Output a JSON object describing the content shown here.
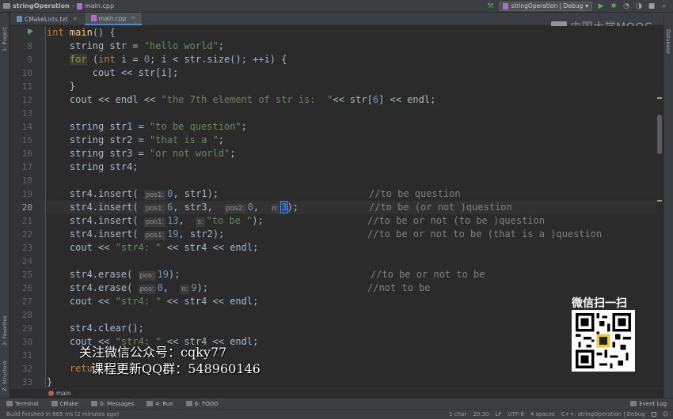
{
  "titlebar": {
    "project": "stringOperation",
    "file": "main.cpp",
    "run_config": "stringOperation | Debug"
  },
  "left_tools": {
    "project": "1: Project",
    "favorites": "2: Favorites",
    "structure": "Z: Structure"
  },
  "right_tools": {
    "database": "Database"
  },
  "tabs": [
    {
      "label": "CMakeLists.txt",
      "active": false
    },
    {
      "label": "main.cpp",
      "active": true
    }
  ],
  "watermark": "中国大学MOOC",
  "line_numbers": [
    "7",
    "8",
    "9",
    "10",
    "11",
    "12",
    "13",
    "14",
    "15",
    "16",
    "17",
    "18",
    "19",
    "20",
    "21",
    "22",
    "23",
    "24",
    "25",
    "26",
    "27",
    "28",
    "29",
    "30",
    "31",
    "32",
    "33"
  ],
  "current_line": "20",
  "code": {
    "l7_kw": "int",
    "l7_fn": "main",
    "l7_rest": "() {",
    "l8_a": "    string str = ",
    "l8_s": "\"hello world\"",
    "l8_b": ";",
    "l9_kw": "for",
    "l9_a": " (",
    "l9_kw2": "int",
    "l9_b": " i = ",
    "l9_n": "0",
    "l9_c": "; i < str.size(); ++i) {",
    "l10": "        cout << str[i];",
    "l11": "    }",
    "l12_a": "    cout << endl << ",
    "l12_s": "\"the 7th element of str is:  \"",
    "l12_b": "<< str[",
    "l12_n": "6",
    "l12_c": "] << endl;",
    "l14_a": "    string str1 = ",
    "l14_s": "\"to be question\"",
    "l14_b": ";",
    "l15_a": "    string str2 = ",
    "l15_s": "\"that is a \"",
    "l15_b": ";",
    "l16_a": "    string str3 = ",
    "l16_s": "\"or not world\"",
    "l16_b": ";",
    "l17": "    string str4;",
    "l19_a": "    str4.insert( ",
    "l19_h1": "pos1:",
    "l19_n1": "0",
    "l19_b": ", str1);",
    "l19_c": "//to be question",
    "l20_a": "    str4.insert( ",
    "l20_h1": "pos1:",
    "l20_n1": "6",
    "l20_b": ", str3,  ",
    "l20_h2": "pos2:",
    "l20_n2": "0",
    "l20_c": ",  ",
    "l20_h3": "n:",
    "l20_n3": "3",
    "l20_d": ");",
    "l20_cmt": "//to be (or not )question",
    "l21_a": "    str4.insert( ",
    "l21_h1": "pos1:",
    "l21_n1": "13",
    "l21_b": ",  ",
    "l21_h2": "s:",
    "l21_s": "\"to be \"",
    "l21_c": ");",
    "l21_cmt": "//to be or not (to be )question",
    "l22_a": "    str4.insert( ",
    "l22_h1": "pos1:",
    "l22_n1": "19",
    "l22_b": ", str2);",
    "l22_cmt": "//to be or not to be (that is a )question",
    "l23_a": "    cout << ",
    "l23_s": "\"str4: \"",
    "l23_b": " << str4 << endl;",
    "l25_a": "    str4.erase( ",
    "l25_h1": "pos:",
    "l25_n1": "19",
    "l25_b": ");",
    "l25_cmt": "//to be or not to be",
    "l26_a": "    str4.erase( ",
    "l26_h1": "pos:",
    "l26_n1": "0",
    "l26_b": ",  ",
    "l26_h2": "n:",
    "l26_n2": "9",
    "l26_c": ");",
    "l26_cmt": "//not to be",
    "l27_a": "    cout << ",
    "l27_s": "\"str4: \"",
    "l27_b": " << str4 << endl;",
    "l29": "    str4.clear();",
    "l30_a": "    cout << ",
    "l30_s": "\"str4: \"",
    "l30_b": " << str4 << endl;",
    "l32_a": "    ",
    "l32_kw": "return",
    "l32_b": " ",
    "l33": "}"
  },
  "promo": {
    "line1": "关注微信公众号：cqky77",
    "line2": "课程更新QQ群：548960146"
  },
  "qr_title": "微信扫一扫",
  "breadcrumb": {
    "function": "main"
  },
  "tool_windows": {
    "terminal": "Terminal",
    "cmake": "CMake",
    "messages": "0: Messages",
    "run": "4: Run",
    "todo": "6: TODO",
    "event_log": "Event Log"
  },
  "status": {
    "message": "Build finished in 665 ms (2 minutes ago)",
    "selection": "1 char",
    "position": "20:30",
    "line_sep": "LF",
    "encoding": "UTF-8",
    "indent": "4 spaces",
    "context": "C++: stringOperation | Debug"
  },
  "colors": {
    "background": "#2b2b2b",
    "keyword": "#cc7832",
    "string": "#6a8759",
    "number": "#6897bb",
    "comment": "#808080",
    "function": "#ffc66d",
    "text": "#a9b7c6"
  }
}
